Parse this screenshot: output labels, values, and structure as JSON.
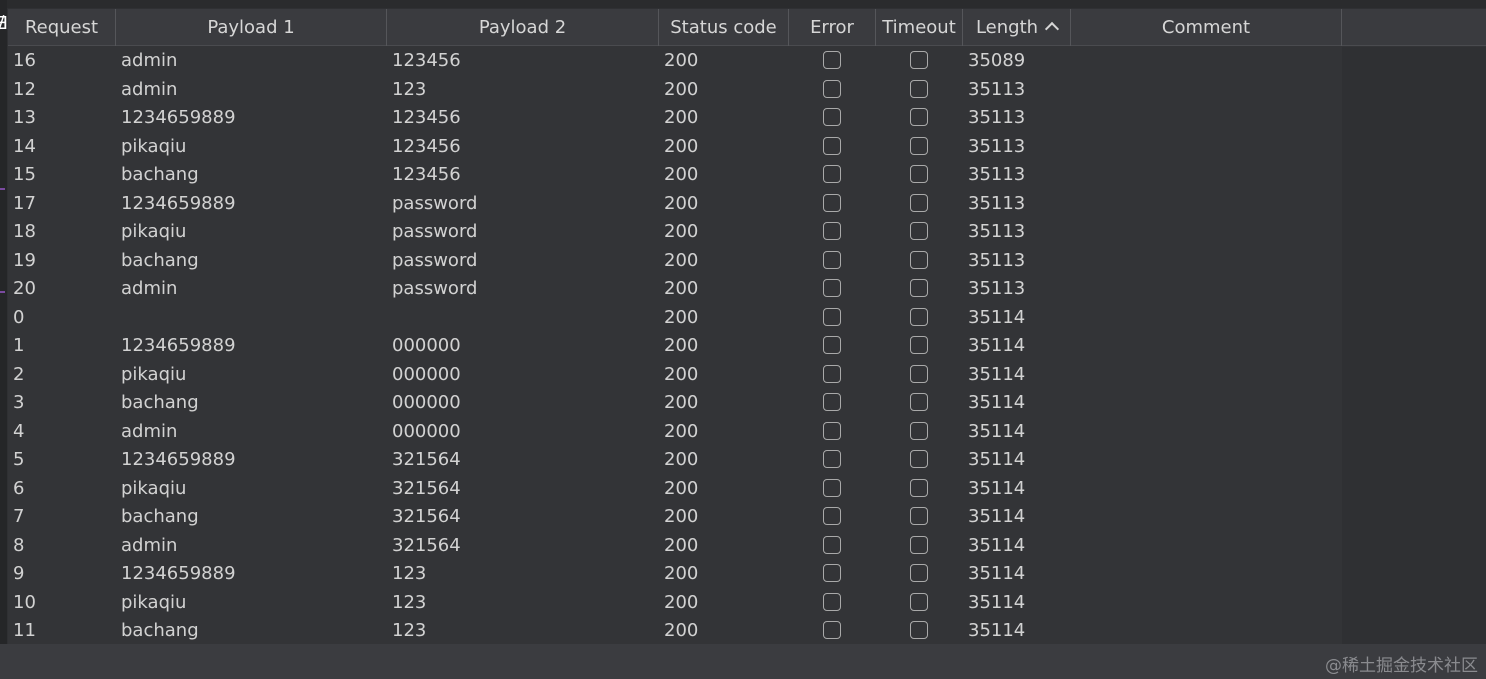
{
  "table": {
    "columns": [
      {
        "key": "request",
        "label": "Request"
      },
      {
        "key": "payload1",
        "label": "Payload 1"
      },
      {
        "key": "payload2",
        "label": "Payload 2"
      },
      {
        "key": "status",
        "label": "Status code"
      },
      {
        "key": "error",
        "label": "Error"
      },
      {
        "key": "timeout",
        "label": "Timeout"
      },
      {
        "key": "length",
        "label": "Length",
        "sort": "ascending"
      },
      {
        "key": "comment",
        "label": "Comment"
      }
    ],
    "rows": [
      {
        "request": "16",
        "payload1": "admin",
        "payload2": "123456",
        "status": "200",
        "error": false,
        "timeout": false,
        "length": "35089"
      },
      {
        "request": "12",
        "payload1": "admin",
        "payload2": "123",
        "status": "200",
        "error": false,
        "timeout": false,
        "length": "35113"
      },
      {
        "request": "13",
        "payload1": "1234659889",
        "payload2": "123456",
        "status": "200",
        "error": false,
        "timeout": false,
        "length": "35113"
      },
      {
        "request": "14",
        "payload1": "pikaqiu",
        "payload2": "123456",
        "status": "200",
        "error": false,
        "timeout": false,
        "length": "35113"
      },
      {
        "request": "15",
        "payload1": "bachang",
        "payload2": "123456",
        "status": "200",
        "error": false,
        "timeout": false,
        "length": "35113"
      },
      {
        "request": "17",
        "payload1": "1234659889",
        "payload2": "password",
        "status": "200",
        "error": false,
        "timeout": false,
        "length": "35113"
      },
      {
        "request": "18",
        "payload1": "pikaqiu",
        "payload2": "password",
        "status": "200",
        "error": false,
        "timeout": false,
        "length": "35113"
      },
      {
        "request": "19",
        "payload1": "bachang",
        "payload2": "password",
        "status": "200",
        "error": false,
        "timeout": false,
        "length": "35113"
      },
      {
        "request": "20",
        "payload1": "admin",
        "payload2": "password",
        "status": "200",
        "error": false,
        "timeout": false,
        "length": "35113"
      },
      {
        "request": "0",
        "payload1": "",
        "payload2": "",
        "status": "200",
        "error": false,
        "timeout": false,
        "length": "35114"
      },
      {
        "request": "1",
        "payload1": "1234659889",
        "payload2": "000000",
        "status": "200",
        "error": false,
        "timeout": false,
        "length": "35114"
      },
      {
        "request": "2",
        "payload1": "pikaqiu",
        "payload2": "000000",
        "status": "200",
        "error": false,
        "timeout": false,
        "length": "35114"
      },
      {
        "request": "3",
        "payload1": "bachang",
        "payload2": "000000",
        "status": "200",
        "error": false,
        "timeout": false,
        "length": "35114"
      },
      {
        "request": "4",
        "payload1": "admin",
        "payload2": "000000",
        "status": "200",
        "error": false,
        "timeout": false,
        "length": "35114"
      },
      {
        "request": "5",
        "payload1": "1234659889",
        "payload2": "321564",
        "status": "200",
        "error": false,
        "timeout": false,
        "length": "35114"
      },
      {
        "request": "6",
        "payload1": "pikaqiu",
        "payload2": "321564",
        "status": "200",
        "error": false,
        "timeout": false,
        "length": "35114"
      },
      {
        "request": "7",
        "payload1": "bachang",
        "payload2": "321564",
        "status": "200",
        "error": false,
        "timeout": false,
        "length": "35114"
      },
      {
        "request": "8",
        "payload1": "admin",
        "payload2": "321564",
        "status": "200",
        "error": false,
        "timeout": false,
        "length": "35114"
      },
      {
        "request": "9",
        "payload1": "1234659889",
        "payload2": "123",
        "status": "200",
        "error": false,
        "timeout": false,
        "length": "35114"
      },
      {
        "request": "10",
        "payload1": "pikaqiu",
        "payload2": "123",
        "status": "200",
        "error": false,
        "timeout": false,
        "length": "35114"
      },
      {
        "request": "11",
        "payload1": "bachang",
        "payload2": "123",
        "status": "200",
        "error": false,
        "timeout": false,
        "length": "35114"
      }
    ]
  },
  "icons": {
    "sort": "chevron-up-icon",
    "checkbox": "checkbox-unchecked"
  },
  "colors": {
    "background": "#2f3033",
    "header": "#3a3b3f",
    "text": "#d2d2d2",
    "checkbox_border": "#a9a9a9"
  },
  "watermark": "@稀土掘金技术社区"
}
